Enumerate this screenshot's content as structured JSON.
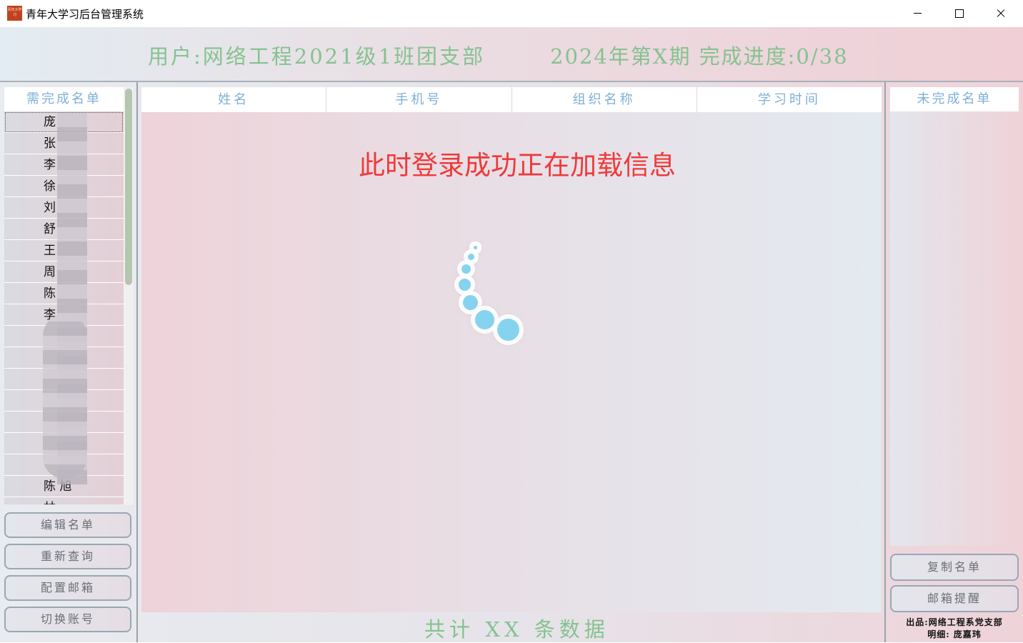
{
  "window": {
    "title": "青年大学习后台管理系统",
    "logo_text": "青年大学习"
  },
  "header": {
    "user_text": "用户:网络工程2021级1班团支部",
    "period_text": "2024年第X期 完成进度:0/38"
  },
  "left_panel": {
    "title": "需完成名单",
    "rows": [
      "庞",
      "张",
      "李",
      "徐",
      "刘",
      "舒",
      "王",
      "周",
      "陈",
      "李",
      "",
      "",
      "",
      "",
      "",
      "",
      "",
      "陈 旭",
      "林"
    ],
    "buttons": [
      "编辑名单",
      "重新查询",
      "配置邮箱",
      "切换账号"
    ]
  },
  "table": {
    "columns": [
      "姓名",
      "手机号",
      "组织名称",
      "学习时间"
    ]
  },
  "center": {
    "loading_text": "此时登录成功正在加载信息",
    "footer_text": "共计 XX 条数据"
  },
  "right_panel": {
    "title": "未完成名单",
    "buttons": [
      "复制名单",
      "邮箱提醒"
    ],
    "credit_line1": "出品:网络工程系党支部",
    "credit_line2": "明细: 庞嘉玮"
  },
  "colors": {
    "accent_green": "#86c290",
    "header_blue": "#7fb0d6",
    "loading_red": "#ee3a3a",
    "spinner_blue": "#86d3ef"
  }
}
